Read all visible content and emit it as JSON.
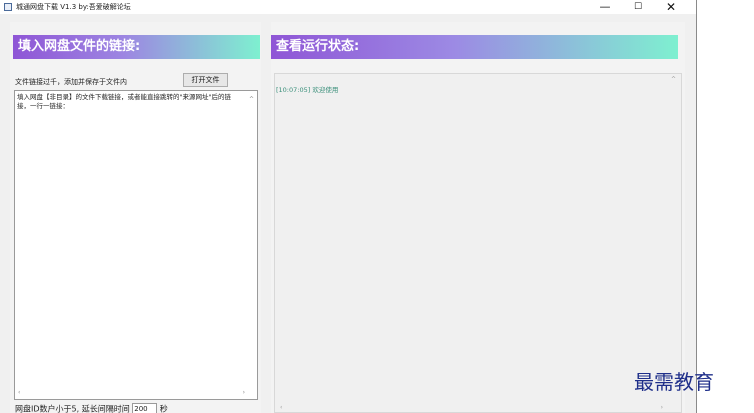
{
  "window": {
    "title": "城通网盘下载 V1.3 by:吾爱破解论坛",
    "controls": {
      "minimize": "—",
      "maximize": "☐",
      "close": "✕"
    }
  },
  "left_panel": {
    "heading": "填入网盘文件的链接:",
    "hint": "文件链接过千，添加并保存于文件内",
    "open_file_button": "打开文件",
    "textarea_text": "填入网盘【非目录】的文件下载链接，或者能直接跳转的\"来源网址\"后的链接，一行一链接：",
    "footer_left": "网盘ID数户小于5",
    "footer_mid": "延长间隔时间",
    "delay_value": "200",
    "delay_unit": "秒"
  },
  "right_panel": {
    "heading": "查看运行状态:",
    "log_line": "[10:07:05] 欢迎使用"
  },
  "watermark": "最需教育"
}
